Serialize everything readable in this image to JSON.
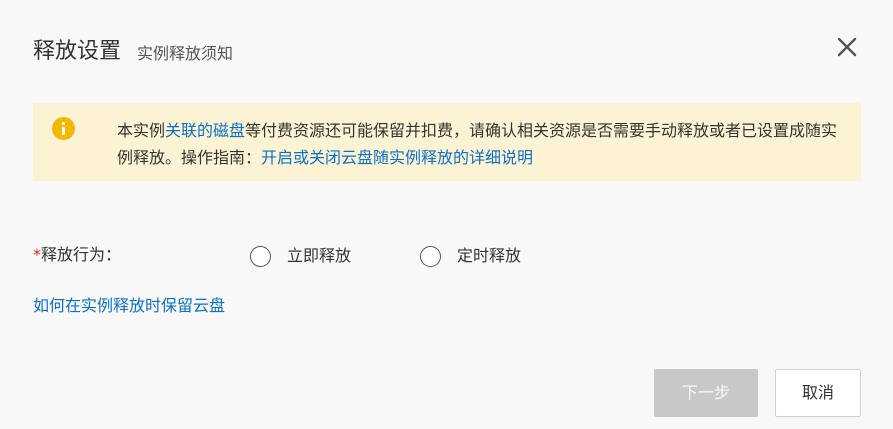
{
  "dialog": {
    "title": "释放设置",
    "subtitle": "实例释放须知",
    "close_icon": "close-icon"
  },
  "notice": {
    "icon": "info-icon",
    "icon_color": "#f5b800",
    "background": "#fcf3d4",
    "text_1": "本实例",
    "link_1": "关联的磁盘",
    "text_2": "等付费资源还可能保留并扣费，请确认相关资源是否需要手动释放或者已设置成随实例释放。操作指南：",
    "link_2": "开启或关闭云盘随实例释放的详细说明"
  },
  "release_behavior": {
    "required_mark": "*",
    "label": "释放行为：",
    "options": [
      "立即释放",
      "定时释放"
    ]
  },
  "help_link": "如何在实例释放时保留云盘",
  "footer": {
    "next_label": "下一步",
    "cancel_label": "取消"
  },
  "colors": {
    "link": "#0c70c9",
    "required": "#d9262c",
    "disabled_button": "#c8c8c8"
  }
}
